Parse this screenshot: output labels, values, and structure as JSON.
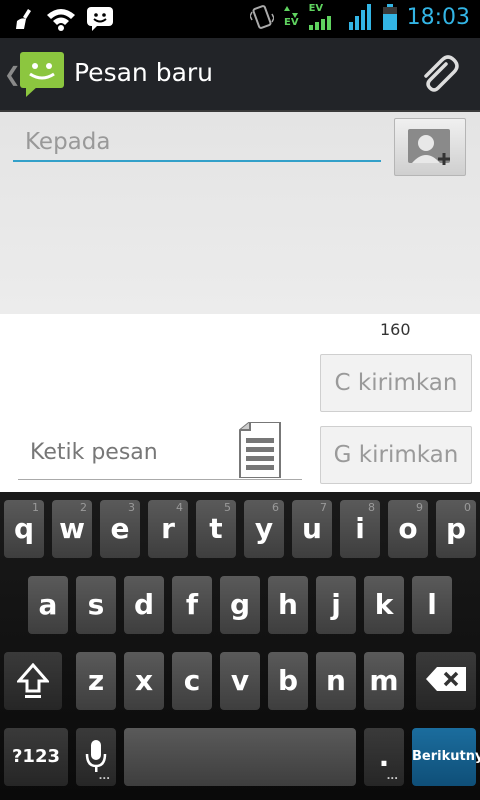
{
  "status_bar": {
    "time": "18:03",
    "network_top": "EV",
    "network_bottom": "EV",
    "icons": [
      "cleaner-icon",
      "wifi-icon",
      "messenger-icon",
      "vibrate-icon",
      "data-arrows-icon",
      "signal-icon",
      "battery-icon"
    ]
  },
  "action_bar": {
    "back_glyph": "❮",
    "title": "Pesan baru",
    "icons": [
      "messaging-app-icon",
      "paperclip-icon"
    ]
  },
  "recipient": {
    "placeholder": "Kepada"
  },
  "compose": {
    "char_count": "160",
    "send_c_label": "C kirimkan",
    "send_g_label": "G kirimkan",
    "message_placeholder": "Ketik pesan"
  },
  "keyboard": {
    "row1": [
      {
        "label": "q",
        "hint": "1"
      },
      {
        "label": "w",
        "hint": "2"
      },
      {
        "label": "e",
        "hint": "3"
      },
      {
        "label": "r",
        "hint": "4"
      },
      {
        "label": "t",
        "hint": "5"
      },
      {
        "label": "y",
        "hint": "6"
      },
      {
        "label": "u",
        "hint": "7"
      },
      {
        "label": "i",
        "hint": "8"
      },
      {
        "label": "o",
        "hint": "9"
      },
      {
        "label": "p",
        "hint": "0"
      }
    ],
    "row2": [
      "a",
      "s",
      "d",
      "f",
      "g",
      "h",
      "j",
      "k",
      "l"
    ],
    "row3": [
      "z",
      "x",
      "c",
      "v",
      "b",
      "n",
      "m"
    ],
    "symbols_label": "?123",
    "period_label": ".",
    "period_hint": "...",
    "mic_hint": "...",
    "action_label": "Berikutnya",
    "accent_color": "#33b5e5"
  }
}
